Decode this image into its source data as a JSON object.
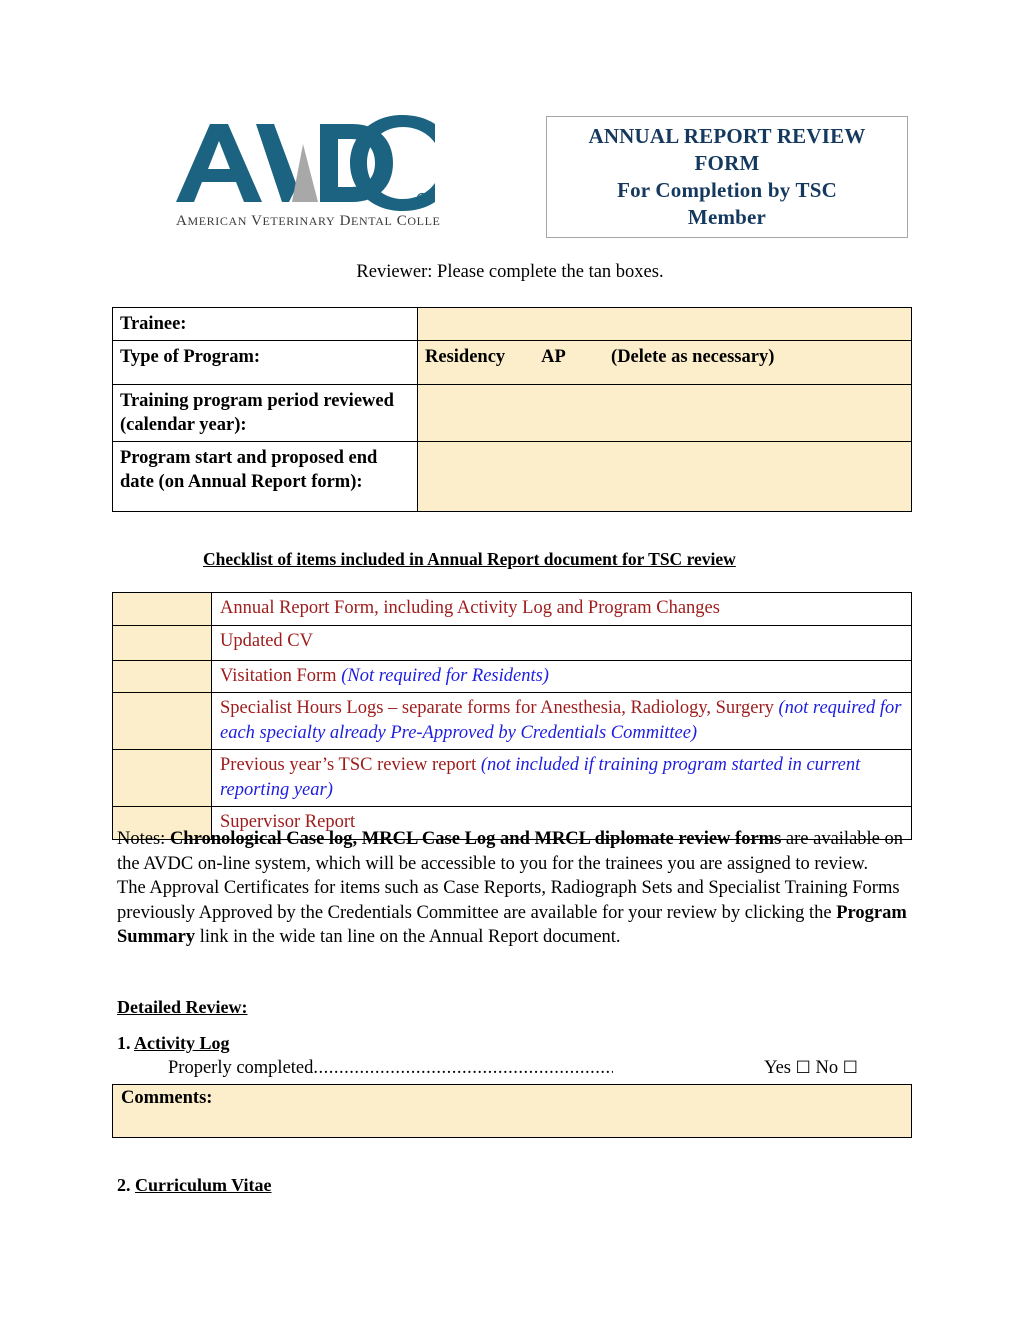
{
  "colors": {
    "tan_fill": "#fceecb",
    "title_navy": "#15395e",
    "checklist_red": "#9e1b1b",
    "note_blue": "#1d1de0",
    "logo_teal": "#1b6380",
    "logo_gray": "#a8a8a8"
  },
  "header": {
    "logo": {
      "wordmark": "AVDC",
      "registered_mark": "®",
      "subtitle": "AMERICAN VETERINARY DENTAL COLLEGE"
    },
    "title_lines": [
      "ANNUAL REPORT REVIEW FORM",
      "For Completion by TSC",
      "Member"
    ]
  },
  "reviewer_note": "Reviewer: Please complete the tan boxes.",
  "trainee_table": {
    "rows": [
      {
        "label": "Trainee:",
        "value": ""
      },
      {
        "label": "Type of Program:",
        "value": "Residency        AP          (Delete as necessary)"
      },
      {
        "label": "Training program period reviewed (calendar year):",
        "value": ""
      },
      {
        "label": "Program start and proposed end date (on Annual Report form):",
        "value": ""
      }
    ]
  },
  "checklist": {
    "heading": "Checklist of items included in Annual Report document for TSC review",
    "items": [
      {
        "main": "Annual Report Form, including Activity Log and Program Changes",
        "note": ""
      },
      {
        "main": "Updated CV",
        "note": ""
      },
      {
        "main": "Visitation Form ",
        "note": "(Not required for Residents)"
      },
      {
        "main": "Specialist Hours Logs – separate forms for Anesthesia, Radiology, Surgery ",
        "note": "(not required for each specialty already Pre-Approved by Credentials Committee)"
      },
      {
        "main": "Previous year’s TSC review report ",
        "note": "(not included if training program started in current reporting year)"
      },
      {
        "main": "Supervisor Report",
        "note": ""
      }
    ]
  },
  "notes": {
    "para1_prefix": "Notes: ",
    "para1_bold": "Chronological Case log, MRCL Case Log and MRCL diplomate review forms",
    "para1_rest": " are available on the AVDC on-line system, which will be accessible to you for the trainees you are assigned to review.",
    "para2_prefix": "The Approval Certificates for items such as Case Reports, Radiograph Sets and Specialist Training Forms previously Approved by the Credentials Committee are available for your review by clicking the ",
    "para2_bold": "Program Summary",
    "para2_rest": " link in the wide tan line on the Annual Report document."
  },
  "detailed_review": {
    "heading": "Detailed Review:",
    "section1": {
      "number": "1. ",
      "title": "Activity Log"
    },
    "section2": {
      "number": "2. ",
      "title": "Curriculum Vitae"
    },
    "properly_completed": {
      "text": "Properly completed",
      "dots": "...............................................................",
      "yes_label": "Yes",
      "no_label": "No",
      "checkbox_glyph": "☐"
    },
    "comments_label": "Comments:"
  }
}
